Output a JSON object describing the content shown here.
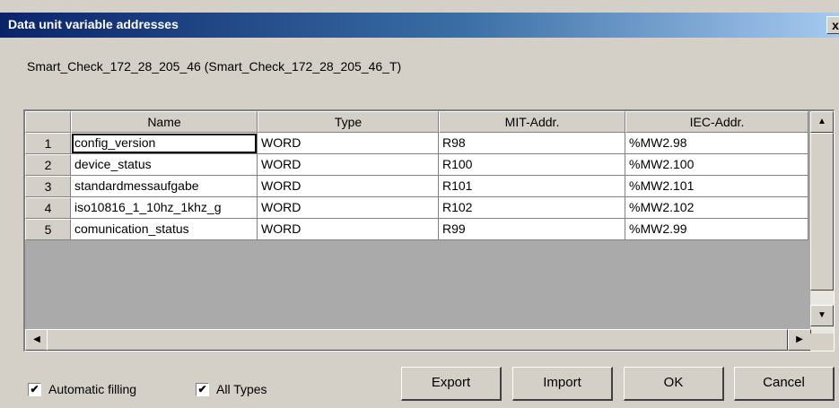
{
  "window": {
    "title": "Data unit variable addresses",
    "close": "x"
  },
  "subtitle": "Smart_Check_172_28_205_46 (Smart_Check_172_28_205_46_T)",
  "table": {
    "columns": [
      "Name",
      "Type",
      "MIT-Addr.",
      "IEC-Addr."
    ],
    "rows": [
      {
        "num": "1",
        "name": "config_version",
        "type": "WORD",
        "mit": "R98",
        "iec": "%MW2.98"
      },
      {
        "num": "2",
        "name": "device_status",
        "type": "WORD",
        "mit": "R100",
        "iec": "%MW2.100"
      },
      {
        "num": "3",
        "name": "standardmessaufgabe",
        "type": "WORD",
        "mit": "R101",
        "iec": "%MW2.101"
      },
      {
        "num": "4",
        "name": "iso10816_1_10hz_1khz_g",
        "type": "WORD",
        "mit": "R102",
        "iec": "%MW2.102"
      },
      {
        "num": "5",
        "name": "comunication_status",
        "type": "WORD",
        "mit": "R99",
        "iec": "%MW2.99"
      }
    ]
  },
  "scroll": {
    "up": "▲",
    "down": "▼",
    "left": "◀",
    "right": "▶"
  },
  "options": {
    "automatic_filling": {
      "label": "Automatic filling",
      "checked": true
    },
    "all_types": {
      "label": "All Types",
      "checked": true
    }
  },
  "buttons": {
    "export": "Export",
    "import": "Import",
    "ok": "OK",
    "cancel": "Cancel"
  }
}
